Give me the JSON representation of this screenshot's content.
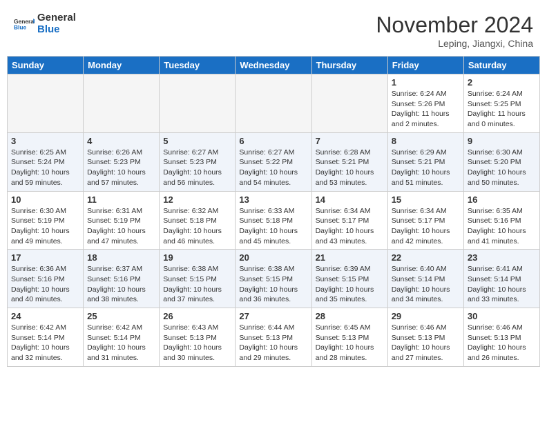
{
  "header": {
    "logo_line1": "General",
    "logo_line2": "Blue",
    "month": "November 2024",
    "location": "Leping, Jiangxi, China"
  },
  "days_of_week": [
    "Sunday",
    "Monday",
    "Tuesday",
    "Wednesday",
    "Thursday",
    "Friday",
    "Saturday"
  ],
  "weeks": [
    {
      "days": [
        {
          "date": "",
          "info": ""
        },
        {
          "date": "",
          "info": ""
        },
        {
          "date": "",
          "info": ""
        },
        {
          "date": "",
          "info": ""
        },
        {
          "date": "",
          "info": ""
        },
        {
          "date": "1",
          "info": "Sunrise: 6:24 AM\nSunset: 5:26 PM\nDaylight: 11 hours and 2 minutes."
        },
        {
          "date": "2",
          "info": "Sunrise: 6:24 AM\nSunset: 5:25 PM\nDaylight: 11 hours and 0 minutes."
        }
      ]
    },
    {
      "days": [
        {
          "date": "3",
          "info": "Sunrise: 6:25 AM\nSunset: 5:24 PM\nDaylight: 10 hours and 59 minutes."
        },
        {
          "date": "4",
          "info": "Sunrise: 6:26 AM\nSunset: 5:23 PM\nDaylight: 10 hours and 57 minutes."
        },
        {
          "date": "5",
          "info": "Sunrise: 6:27 AM\nSunset: 5:23 PM\nDaylight: 10 hours and 56 minutes."
        },
        {
          "date": "6",
          "info": "Sunrise: 6:27 AM\nSunset: 5:22 PM\nDaylight: 10 hours and 54 minutes."
        },
        {
          "date": "7",
          "info": "Sunrise: 6:28 AM\nSunset: 5:21 PM\nDaylight: 10 hours and 53 minutes."
        },
        {
          "date": "8",
          "info": "Sunrise: 6:29 AM\nSunset: 5:21 PM\nDaylight: 10 hours and 51 minutes."
        },
        {
          "date": "9",
          "info": "Sunrise: 6:30 AM\nSunset: 5:20 PM\nDaylight: 10 hours and 50 minutes."
        }
      ]
    },
    {
      "days": [
        {
          "date": "10",
          "info": "Sunrise: 6:30 AM\nSunset: 5:19 PM\nDaylight: 10 hours and 49 minutes."
        },
        {
          "date": "11",
          "info": "Sunrise: 6:31 AM\nSunset: 5:19 PM\nDaylight: 10 hours and 47 minutes."
        },
        {
          "date": "12",
          "info": "Sunrise: 6:32 AM\nSunset: 5:18 PM\nDaylight: 10 hours and 46 minutes."
        },
        {
          "date": "13",
          "info": "Sunrise: 6:33 AM\nSunset: 5:18 PM\nDaylight: 10 hours and 45 minutes."
        },
        {
          "date": "14",
          "info": "Sunrise: 6:34 AM\nSunset: 5:17 PM\nDaylight: 10 hours and 43 minutes."
        },
        {
          "date": "15",
          "info": "Sunrise: 6:34 AM\nSunset: 5:17 PM\nDaylight: 10 hours and 42 minutes."
        },
        {
          "date": "16",
          "info": "Sunrise: 6:35 AM\nSunset: 5:16 PM\nDaylight: 10 hours and 41 minutes."
        }
      ]
    },
    {
      "days": [
        {
          "date": "17",
          "info": "Sunrise: 6:36 AM\nSunset: 5:16 PM\nDaylight: 10 hours and 40 minutes."
        },
        {
          "date": "18",
          "info": "Sunrise: 6:37 AM\nSunset: 5:16 PM\nDaylight: 10 hours and 38 minutes."
        },
        {
          "date": "19",
          "info": "Sunrise: 6:38 AM\nSunset: 5:15 PM\nDaylight: 10 hours and 37 minutes."
        },
        {
          "date": "20",
          "info": "Sunrise: 6:38 AM\nSunset: 5:15 PM\nDaylight: 10 hours and 36 minutes."
        },
        {
          "date": "21",
          "info": "Sunrise: 6:39 AM\nSunset: 5:15 PM\nDaylight: 10 hours and 35 minutes."
        },
        {
          "date": "22",
          "info": "Sunrise: 6:40 AM\nSunset: 5:14 PM\nDaylight: 10 hours and 34 minutes."
        },
        {
          "date": "23",
          "info": "Sunrise: 6:41 AM\nSunset: 5:14 PM\nDaylight: 10 hours and 33 minutes."
        }
      ]
    },
    {
      "days": [
        {
          "date": "24",
          "info": "Sunrise: 6:42 AM\nSunset: 5:14 PM\nDaylight: 10 hours and 32 minutes."
        },
        {
          "date": "25",
          "info": "Sunrise: 6:42 AM\nSunset: 5:14 PM\nDaylight: 10 hours and 31 minutes."
        },
        {
          "date": "26",
          "info": "Sunrise: 6:43 AM\nSunset: 5:13 PM\nDaylight: 10 hours and 30 minutes."
        },
        {
          "date": "27",
          "info": "Sunrise: 6:44 AM\nSunset: 5:13 PM\nDaylight: 10 hours and 29 minutes."
        },
        {
          "date": "28",
          "info": "Sunrise: 6:45 AM\nSunset: 5:13 PM\nDaylight: 10 hours and 28 minutes."
        },
        {
          "date": "29",
          "info": "Sunrise: 6:46 AM\nSunset: 5:13 PM\nDaylight: 10 hours and 27 minutes."
        },
        {
          "date": "30",
          "info": "Sunrise: 6:46 AM\nSunset: 5:13 PM\nDaylight: 10 hours and 26 minutes."
        }
      ]
    }
  ]
}
